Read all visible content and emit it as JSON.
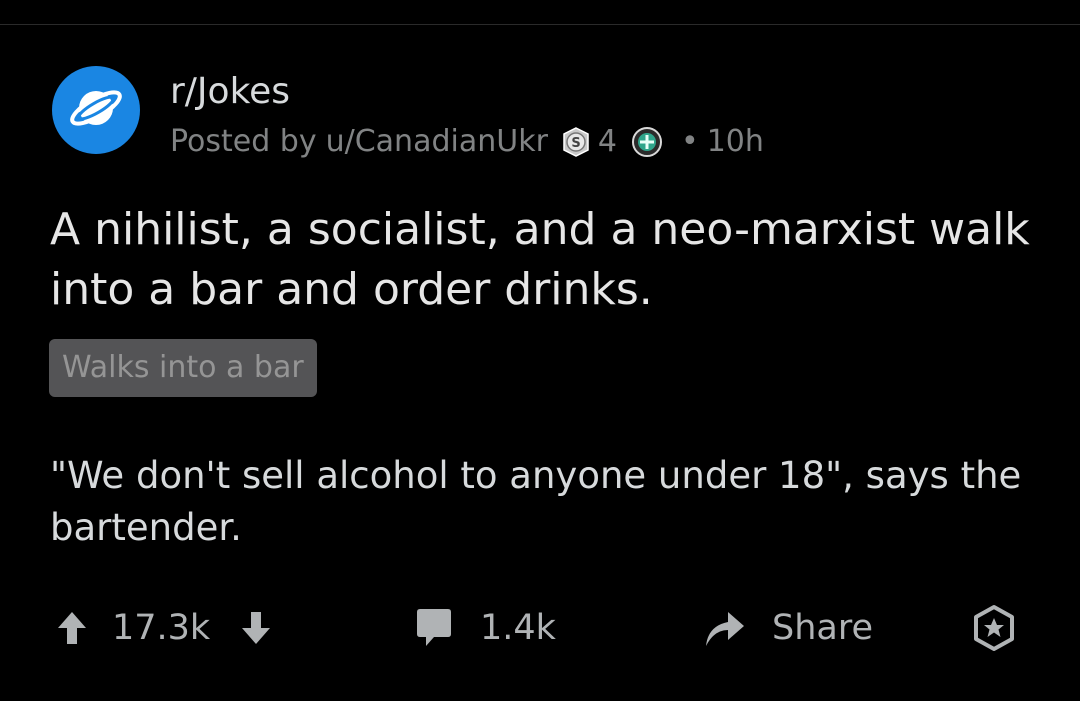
{
  "post": {
    "subreddit": "r/Jokes",
    "posted_by_prefix": "Posted by",
    "username": "u/CanadianUkr",
    "award_count": "4",
    "separator": "•",
    "age": "10h",
    "title": "A nihilist, a socialist, and a neo-marxist walk into a bar and order drinks.",
    "flair": "Walks into a bar",
    "body": "\"We don't sell alcohol to anyone under 18\", says the bartender."
  },
  "actions": {
    "vote_count": "17.3k",
    "comment_count": "1.4k",
    "share_label": "Share"
  },
  "icons": {
    "avatar": "planet-icon",
    "award_1": "silver-award-icon",
    "award_2": "helpful-award-icon",
    "upvote": "arrow-up-icon",
    "downvote": "arrow-down-icon",
    "comment": "comment-bubble-icon",
    "share": "share-arrow-icon",
    "award_post": "gift-award-icon"
  },
  "colors": {
    "background": "#000000",
    "avatar_blue": "#1a86e3",
    "flair_bg": "#545456",
    "meta_gray": "#818384"
  }
}
